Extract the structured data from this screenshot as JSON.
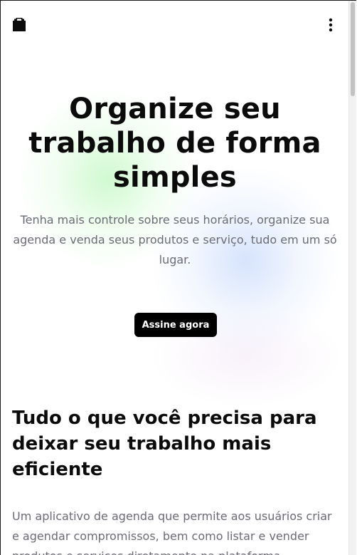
{
  "header": {
    "logo_icon": "shopping-bag-icon",
    "menu_icon": "more-vertical-icon"
  },
  "hero": {
    "title": "Organize seu trabalho de forma simples",
    "subtitle": "Tenha mais controle sobre seus horários, organize sua agenda e venda seus produtos e serviço, tudo em um só lugar.",
    "cta_label": "Assine agora"
  },
  "features": {
    "heading": "Tudo o que você precisa para deixar seu trabalho mais eficiente",
    "description": "Um aplicativo de agenda que permite aos usuários criar e agendar compromissos, bem como listar e vender produtos e serviços diretamente na plataforma."
  },
  "colors": {
    "primary": "#000000",
    "text": "#0b0b0b",
    "muted": "#6b6b75",
    "glow_green": "#aaf5aa",
    "glow_blue": "#b4cdfa"
  }
}
